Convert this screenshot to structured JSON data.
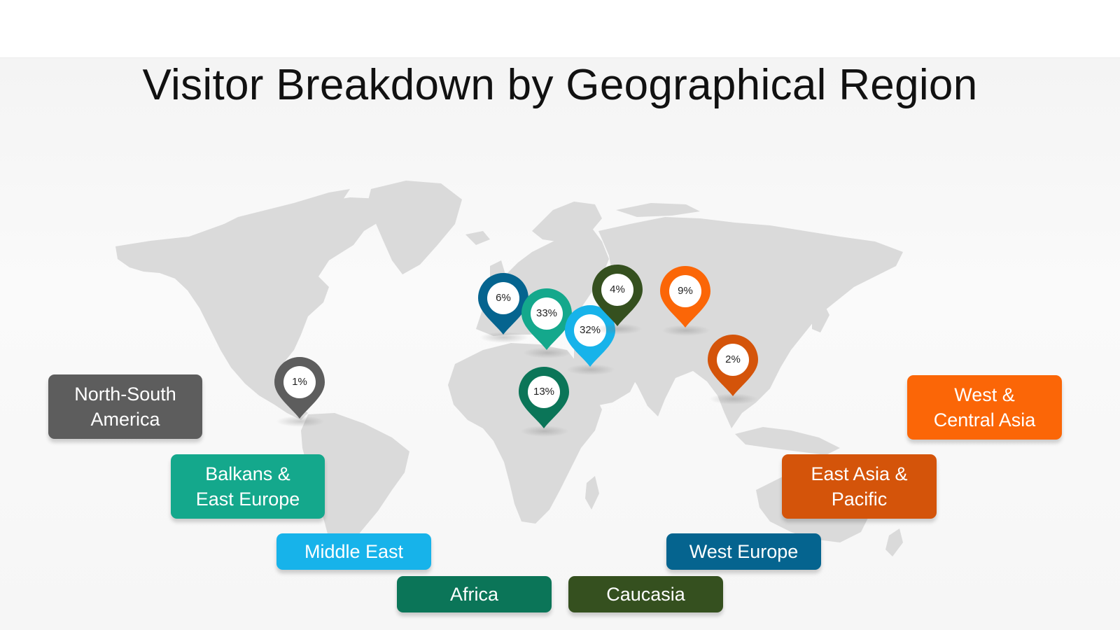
{
  "title": "Visitor Breakdown by Geographical Region",
  "colors": {
    "north_south_america": "#5d5d5d",
    "balkans_east_europe": "#14a88c",
    "middle_east": "#17b3ea",
    "africa": "#0b7558",
    "caucasia": "#35501f",
    "west_europe": "#05648f",
    "east_asia_pacific": "#d4540a",
    "west_central_asia": "#fb6607",
    "map": "#dadada"
  },
  "pins": [
    {
      "id": "north-south-america",
      "value": "1%",
      "color": "#5d5d5d"
    },
    {
      "id": "west-europe",
      "value": "6%",
      "color": "#05648f"
    },
    {
      "id": "balkans-east-europe",
      "value": "33%",
      "color": "#14a88c"
    },
    {
      "id": "middle-east",
      "value": "32%",
      "color": "#17b3ea"
    },
    {
      "id": "caucasia",
      "value": "4%",
      "color": "#35501f"
    },
    {
      "id": "west-central-asia",
      "value": "9%",
      "color": "#fb6607"
    },
    {
      "id": "east-asia-pacific",
      "value": "2%",
      "color": "#d4540a"
    },
    {
      "id": "africa",
      "value": "13%",
      "color": "#0b7558"
    }
  ],
  "legend": {
    "north_south_america": "North-South\nAmerica",
    "balkans_east_europe": "Balkans &\nEast Europe",
    "middle_east": "Middle East",
    "africa": "Africa",
    "caucasia": "Caucasia",
    "west_europe": "West Europe",
    "east_asia_pacific": "East Asia &\nPacific",
    "west_central_asia": "West &\nCentral Asia"
  }
}
